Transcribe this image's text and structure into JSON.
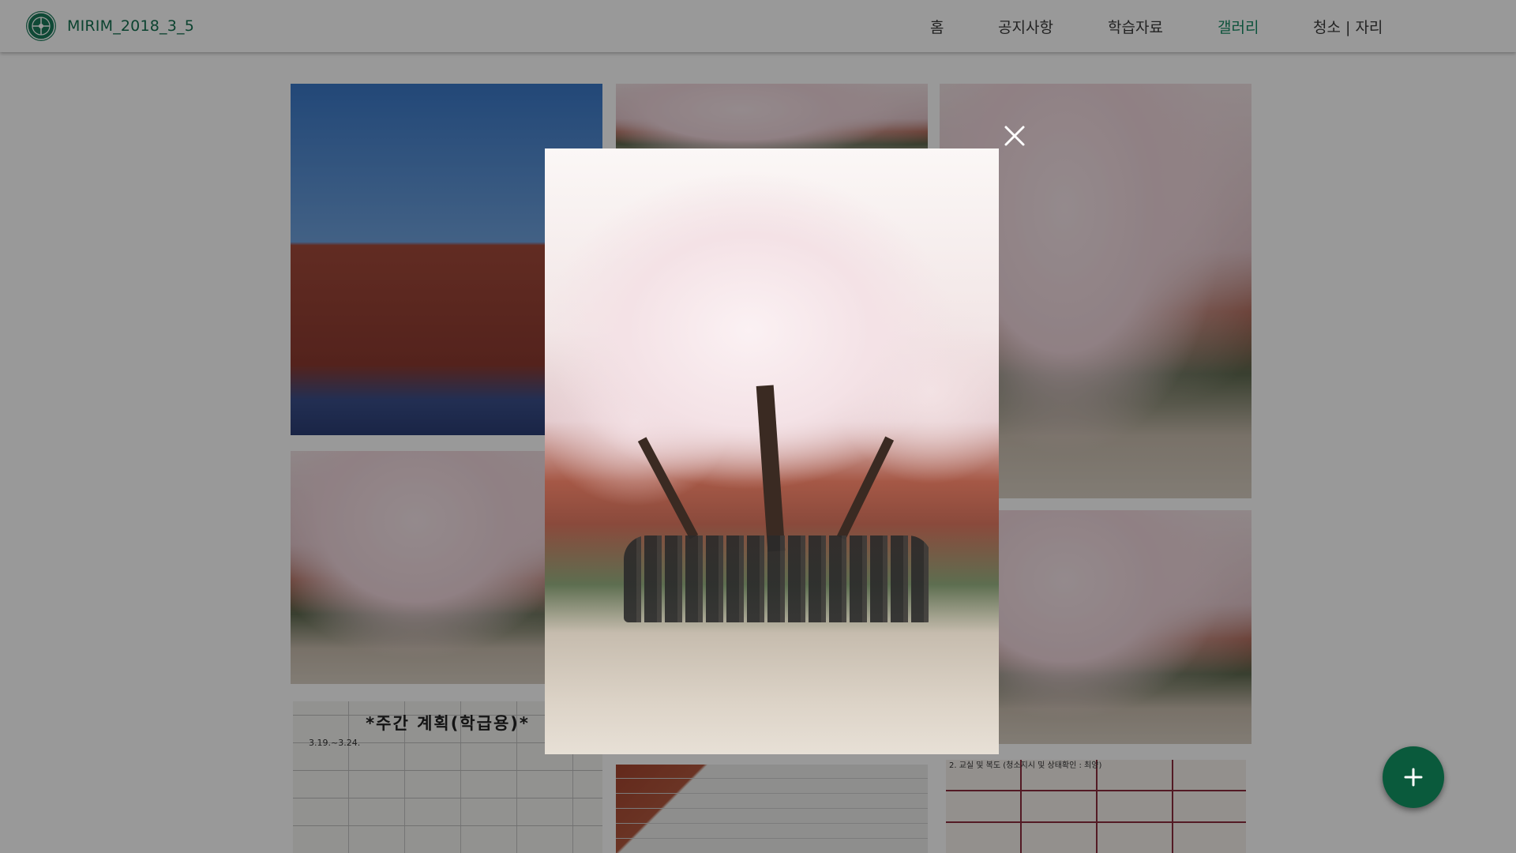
{
  "header": {
    "brand_title": "MIRIM_2018_3_5",
    "logo_icon": "school-emblem-icon",
    "brand_color": "#147050"
  },
  "nav": {
    "items": [
      {
        "label": "홈",
        "active": false
      },
      {
        "label": "공지사항",
        "active": false
      },
      {
        "label": "학습자료",
        "active": false
      },
      {
        "label": "갤러리",
        "active": true
      },
      {
        "label": "청소 | 자리",
        "active": false
      }
    ],
    "active_color": "#178a64"
  },
  "gallery": {
    "documents": {
      "weekly_plan_title": "*주간 계획(학급용)*",
      "weekly_plan_dates": "3.19.~3.24.",
      "cleaning_table_title": "2. 교실 및 복도 (청소지시 및 상태확인 : 최양)"
    }
  },
  "modal": {
    "close_icon": "close-icon",
    "photo": "cherry-blossom-class-photo"
  },
  "fab": {
    "icon": "plus-icon",
    "color": "#0a5a3c"
  }
}
